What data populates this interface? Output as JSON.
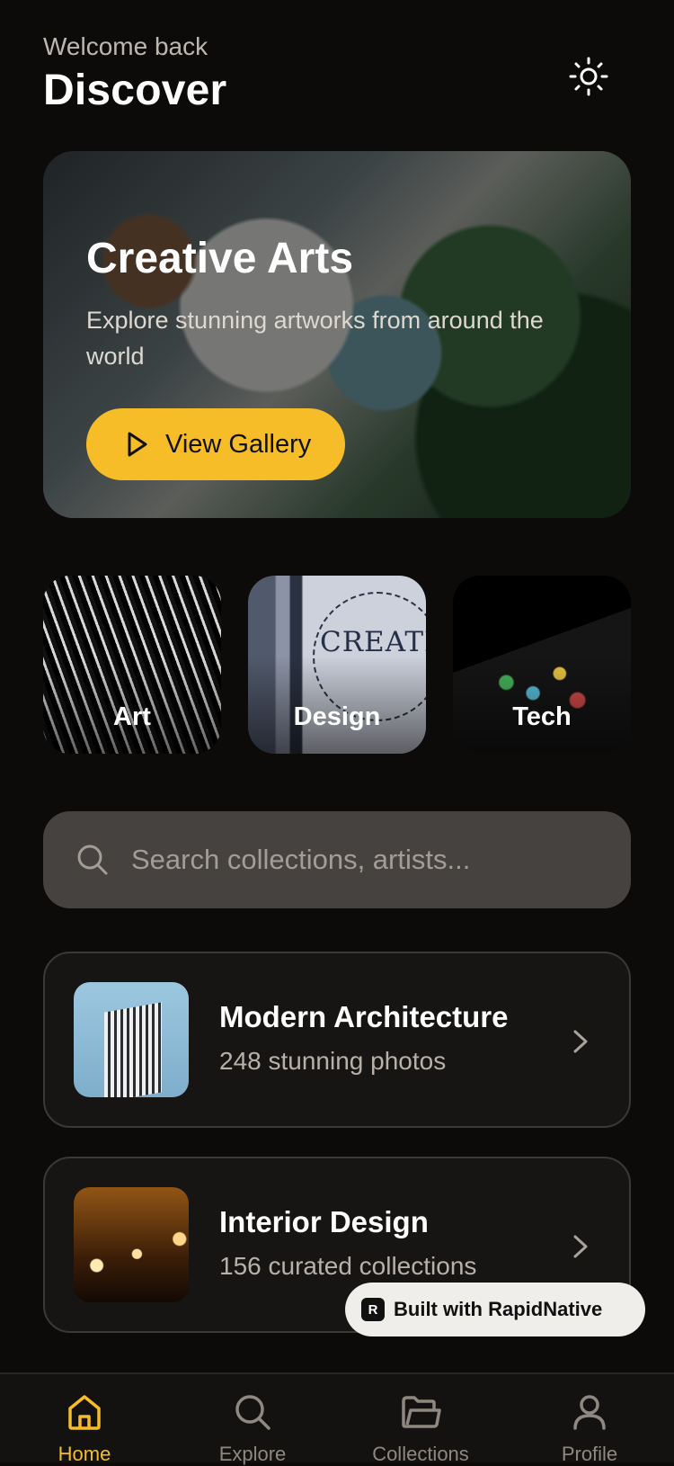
{
  "header": {
    "welcome": "Welcome back",
    "title": "Discover",
    "theme_icon": "sun-icon"
  },
  "hero": {
    "title": "Creative Arts",
    "subtitle": "Explore stunning artworks from around the world",
    "button_label": "View Gallery",
    "button_icon": "play-icon",
    "accent": "#f6bd29"
  },
  "categories": [
    {
      "label": "Art"
    },
    {
      "label": "Design"
    },
    {
      "label": "Tech"
    }
  ],
  "design_tile_text": "CREATIVIT",
  "search": {
    "placeholder": "Search collections, artists...",
    "icon": "search-icon"
  },
  "collections": [
    {
      "title": "Modern Architecture",
      "subtitle": "248 stunning photos"
    },
    {
      "title": "Interior Design",
      "subtitle": "156 curated collections"
    }
  ],
  "badge": {
    "logo": "R",
    "label": "Built with RapidNative"
  },
  "tabs": [
    {
      "label": "Home",
      "icon": "home-icon",
      "active": true
    },
    {
      "label": "Explore",
      "icon": "search-icon",
      "active": false
    },
    {
      "label": "Collections",
      "icon": "folder-icon",
      "active": false
    },
    {
      "label": "Profile",
      "icon": "user-icon",
      "active": false
    }
  ]
}
